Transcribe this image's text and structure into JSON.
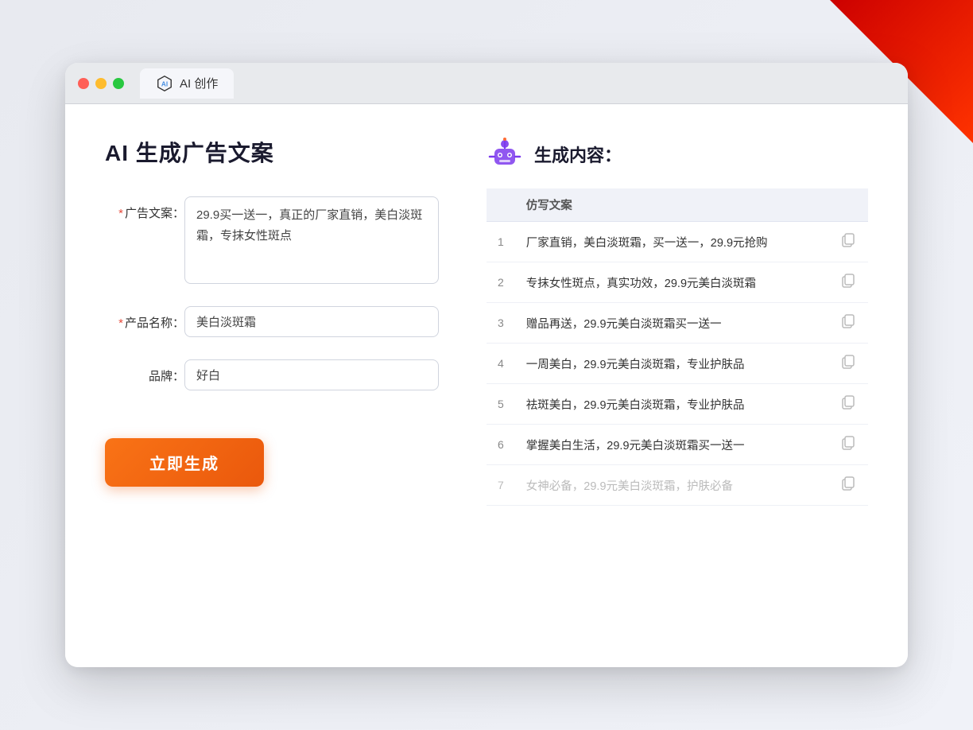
{
  "corner": "decorative",
  "tab": {
    "icon_label": "AI icon",
    "label": "AI 创作"
  },
  "page": {
    "title": "AI 生成广告文案"
  },
  "form": {
    "ad_copy_label": "广告文案：",
    "ad_copy_required": "*",
    "ad_copy_value": "29.9买一送一，真正的厂家直销，美白淡斑霜，专抹女性斑点",
    "product_name_label": "产品名称：",
    "product_name_required": "*",
    "product_name_value": "美白淡斑霜",
    "brand_label": "品牌：",
    "brand_value": "好白",
    "submit_label": "立即生成"
  },
  "results": {
    "header_icon_label": "robot icon",
    "header_title": "生成内容：",
    "table_column": "仿写文案",
    "rows": [
      {
        "num": "1",
        "text": "厂家直销，美白淡斑霜，买一送一，29.9元抢购"
      },
      {
        "num": "2",
        "text": "专抹女性斑点，真实功效，29.9元美白淡斑霜"
      },
      {
        "num": "3",
        "text": "赠品再送，29.9元美白淡斑霜买一送一"
      },
      {
        "num": "4",
        "text": "一周美白，29.9元美白淡斑霜，专业护肤品"
      },
      {
        "num": "5",
        "text": "祛斑美白，29.9元美白淡斑霜，专业护肤品"
      },
      {
        "num": "6",
        "text": "掌握美白生活，29.9元美白淡斑霜买一送一"
      },
      {
        "num": "7",
        "text": "女神必备，29.9元美白淡斑霜，护肤必备",
        "faded": true
      }
    ]
  }
}
